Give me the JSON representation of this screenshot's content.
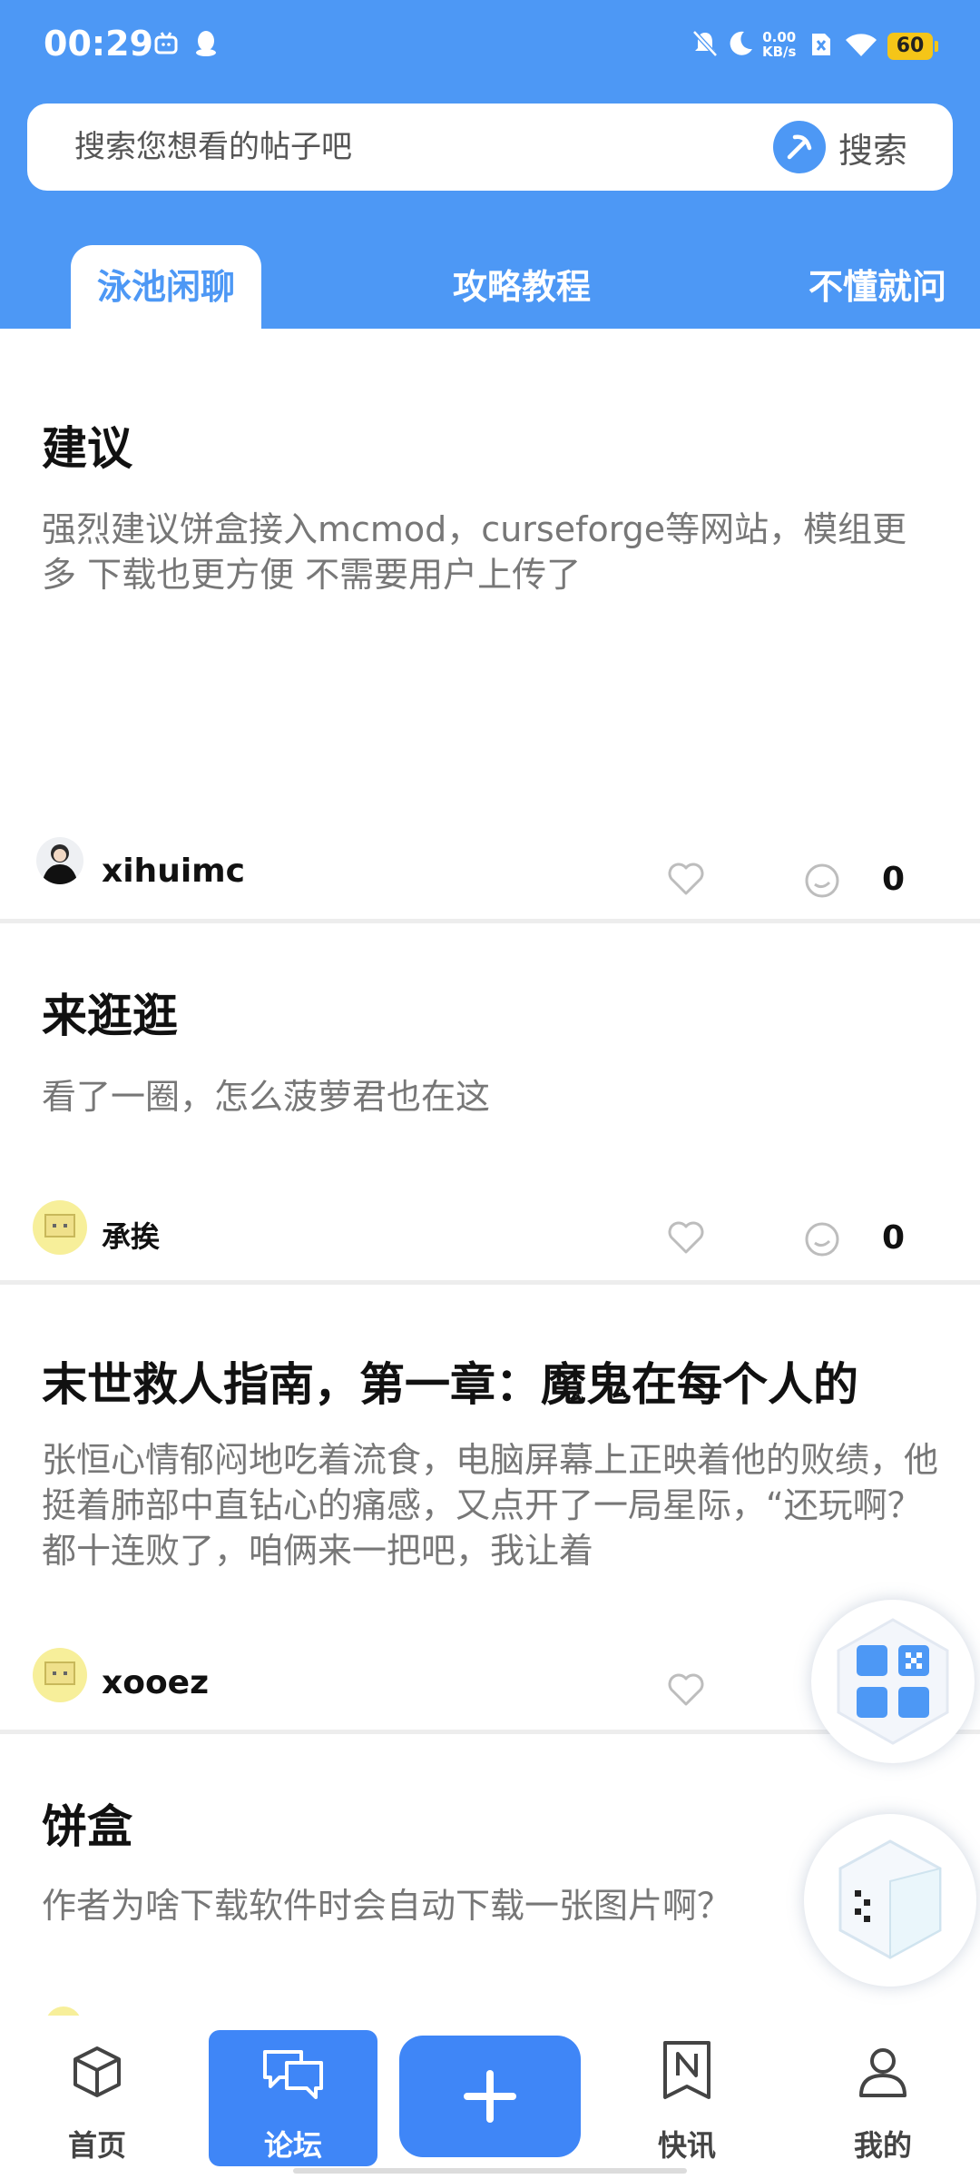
{
  "status_bar": {
    "time": "00:29",
    "net_speed_value": "0.00",
    "net_speed_unit": "KB/s",
    "battery": "60"
  },
  "search": {
    "placeholder": "搜索您想看的帖子吧",
    "button_label": "搜索"
  },
  "tabs": [
    {
      "label": "泳池闲聊",
      "active": true
    },
    {
      "label": "攻略教程",
      "active": false
    },
    {
      "label": "不懂就问",
      "active": false
    }
  ],
  "posts": [
    {
      "title": "建议",
      "body": "强烈建议饼盒接入mcmod，curseforge等网站，模组更多 下载也更方便 不需要用户上传了",
      "author": "xihuimc",
      "comments": "0"
    },
    {
      "title": "来逛逛",
      "body": "看了一圈，怎么菠萝君也在这",
      "author": "承挨",
      "comments": "0"
    },
    {
      "title": "末世救人指南，第一章：魔鬼在每个人的",
      "body": "张恒心情郁闷地吃着流食，电脑屏幕上正映着他的败绩，他挺着肺部中直钻心的痛感，又点开了一局星际，“还玩啊？都十连败了，咱俩来一把吧，我让着",
      "author": "xooez"
    },
    {
      "title": "饼盒",
      "body": "作者为啥下载软件时会自动下载一张图片啊？"
    }
  ],
  "bottom_nav": {
    "home": "首页",
    "forum": "论坛",
    "news": "快讯",
    "mine": "我的"
  },
  "colors": {
    "primary": "#4d98f5",
    "nav_active": "#3f86f7",
    "battery": "#f5c518"
  }
}
